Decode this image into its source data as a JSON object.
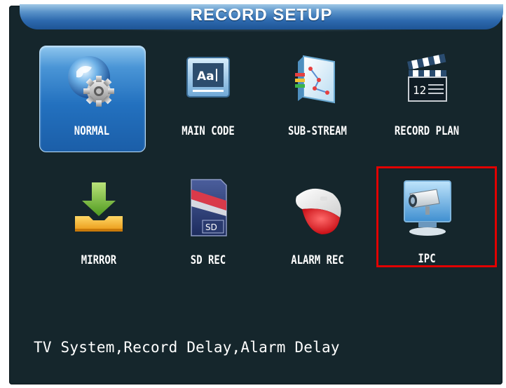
{
  "title": "RECORD SETUP",
  "menu": [
    {
      "label": "NORMAL",
      "icon": "globe-gear-icon",
      "selected": true
    },
    {
      "label": "MAIN CODE",
      "icon": "font-display-icon",
      "selected": false
    },
    {
      "label": "SUB-STREAM",
      "icon": "map-chart-icon",
      "selected": false
    },
    {
      "label": "RECORD PLAN",
      "icon": "clapperboard-icon",
      "selected": false
    },
    {
      "label": "MIRROR",
      "icon": "download-tray-icon",
      "selected": false
    },
    {
      "label": "SD REC",
      "icon": "sd-card-icon",
      "selected": false
    },
    {
      "label": "ALARM REC",
      "icon": "alarm-siren-icon",
      "selected": false
    },
    {
      "label": "IPC",
      "icon": "ip-camera-icon",
      "selected": false
    }
  ],
  "hint": "TV System,Record Delay,Alarm Delay",
  "colors": {
    "background": "#15262c",
    "title_bar": "#2d69ae",
    "selection": "#2371bf",
    "highlight_box": "#e10000",
    "text": "#ffffff"
  }
}
